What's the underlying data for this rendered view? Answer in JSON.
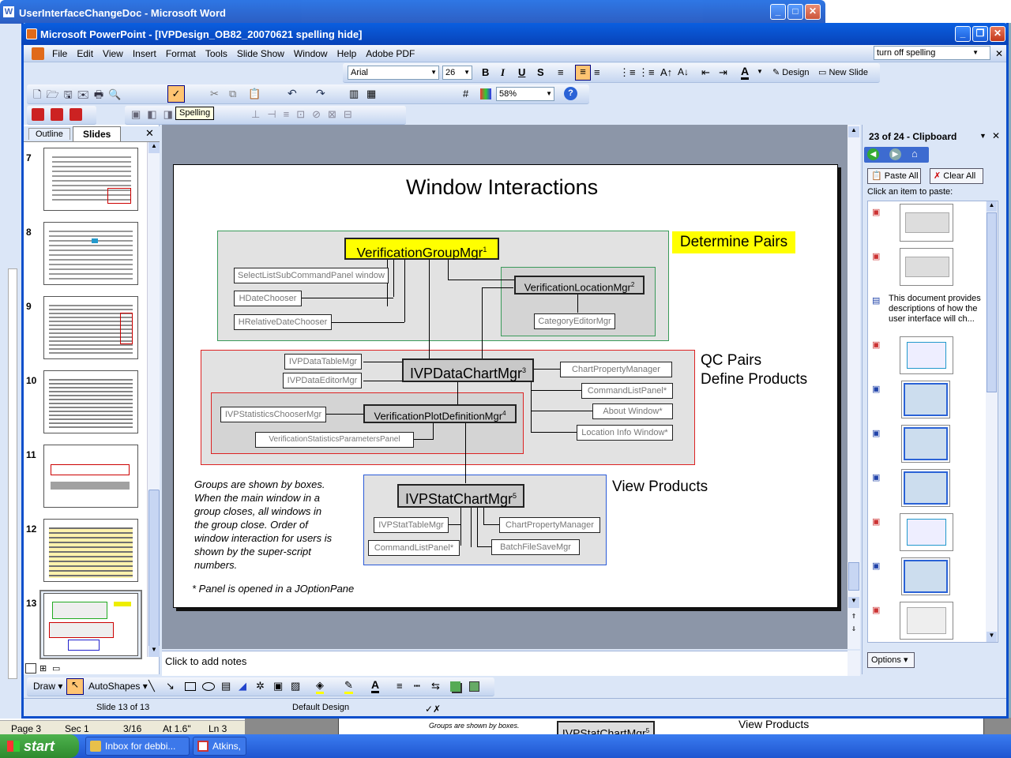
{
  "word_window": {
    "title": "UserInterfaceChangeDoc - Microsoft Word",
    "status": {
      "page": "Page  3",
      "sec": "Sec  1",
      "pos": "3/16",
      "at": "At  1.6\"",
      "ln": "Ln  3"
    }
  },
  "word_doc_snippet": {
    "text1": "Groups are shown by boxes.",
    "text2": "When the main window in a",
    "text3": "group closes, all windows in",
    "box": "IVPStatChartMgr",
    "sup": "5",
    "view": "View Products"
  },
  "ppt_window": {
    "title": "Microsoft PowerPoint - [IVPDesign_OB82_20070621 spelling hide]"
  },
  "menu": [
    "File",
    "Edit",
    "View",
    "Insert",
    "Format",
    "Tools",
    "Slide Show",
    "Window",
    "Help",
    "Adobe PDF"
  ],
  "ask_box": "turn off spelling",
  "format_toolbar": {
    "font": "Arial",
    "size": "26",
    "design": "Design",
    "new_slide": "New Slide"
  },
  "standard_toolbar": {
    "zoom": "58%"
  },
  "tooltip": "Spelling",
  "pane_tabs": [
    "Outline",
    "Slides"
  ],
  "slide_numbers": [
    "7",
    "8",
    "9",
    "10",
    "11",
    "12",
    "13"
  ],
  "slide": {
    "title": "Window Interactions",
    "labels": {
      "determine": "Determine Pairs",
      "qc1": "QC Pairs",
      "qc2": "Define Products",
      "view": "View Products"
    },
    "boxes": {
      "vgm": "VerificationGroupMgr",
      "vgm_sup": "1",
      "slscp": "SelectListSubCommandPanel window",
      "hdc": "HDateChooser",
      "hrdc": "HRelativeDateChooser",
      "vlm": "VerificationLocationMgr",
      "vlm_sup": "2",
      "cem": "CategoryEditorMgr",
      "dtm": "IVPDataTableMgr",
      "dem": "IVPDataEditorMgr",
      "dcm": "IVPDataChartMgr",
      "dcm_sup": "3",
      "cpm": "ChartPropertyManager",
      "clp": "CommandListPanel*",
      "about": "About Window*",
      "liw": "Location Info Window*",
      "vpdm": "VerificationPlotDefinitionMgr",
      "vpdm_sup": "4",
      "iscm": "IVPStatisticsChooserMgr",
      "vspp": "VerificationStatisticsParametersPanel",
      "scm": "IVPStatChartMgr",
      "scm_sup": "5",
      "stm": "IVPStatTableMgr",
      "cpm2": "ChartPropertyManager",
      "clp2": "CommandListPanel*",
      "bfsm": "BatchFileSaveMgr"
    },
    "note_lines": [
      "Groups are shown by boxes.",
      "When the main window in a",
      "group closes, all windows in",
      "the group close.  Order of",
      "window interaction for users is",
      "shown by the super-script",
      "numbers."
    ],
    "footnote": "* Panel is opened in a JOptionPane"
  },
  "notes_placeholder": "Click to add notes",
  "drawing_toolbar": {
    "draw": "Draw",
    "autoshapes": "AutoShapes"
  },
  "statusbar": {
    "slide": "Slide 13 of 13",
    "design": "Default Design"
  },
  "clipboard": {
    "title": "23 of 24 - Clipboard",
    "paste_all": "Paste All",
    "clear_all": "Clear All",
    "hint": "Click an item to paste:",
    "text_item": "This document provides descriptions of how the user interface will ch...",
    "options": "Options"
  },
  "taskbar": {
    "start": "start",
    "items": [
      "Inbox for debbi...",
      "Atkins, D"
    ]
  }
}
